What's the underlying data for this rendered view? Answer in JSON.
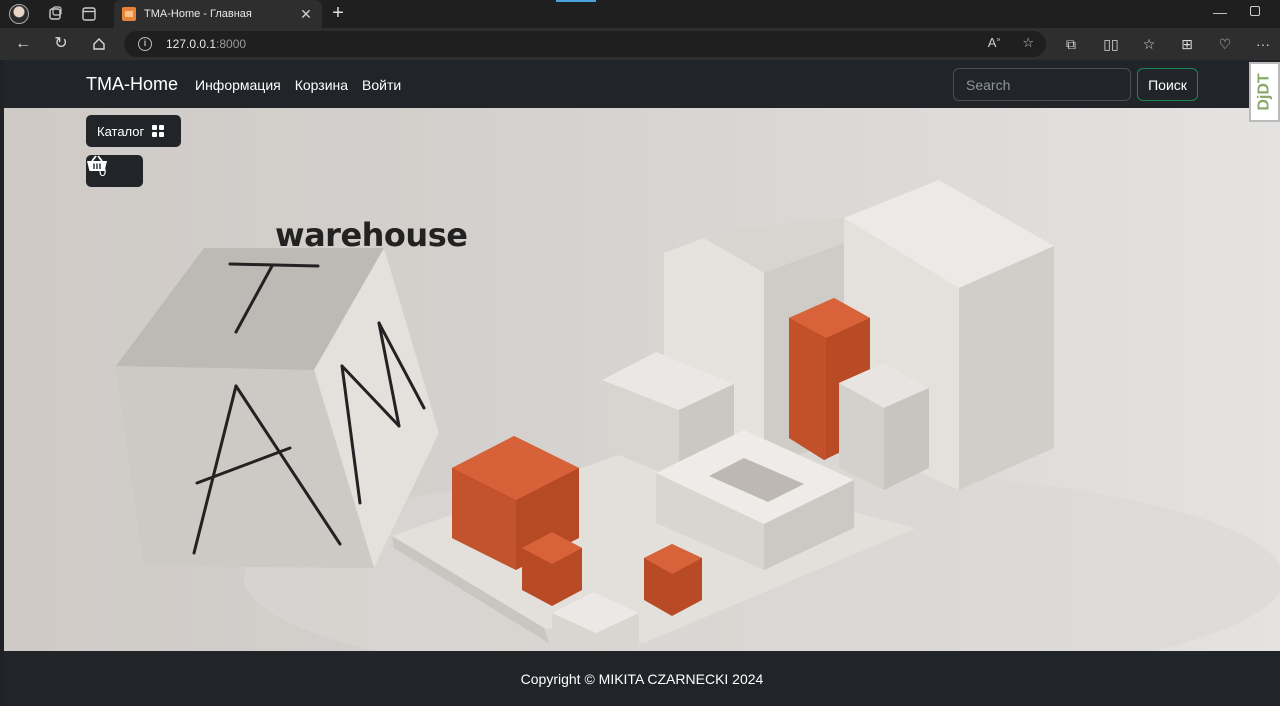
{
  "browser": {
    "tab_title": "TMA-Home - Главная",
    "url_host": "127.0.0.1",
    "url_port": ":8000"
  },
  "navbar": {
    "brand": "TMA-Home",
    "links": [
      "Информация",
      "Корзина",
      "Войти"
    ],
    "search_placeholder": "Search",
    "search_button": "Поиск"
  },
  "debug_toolbar": {
    "label": "DjDT"
  },
  "hero": {
    "catalog_button": "Каталог",
    "cart_count": "0",
    "title": "warehouse",
    "cube_letters": "TAM"
  },
  "footer": {
    "copyright": "Copyright © MIKITA CZARNECKI 2024"
  },
  "colors": {
    "navbar_bg": "#212529",
    "accent_orange": "#c2512a",
    "search_button_border": "#198754"
  }
}
